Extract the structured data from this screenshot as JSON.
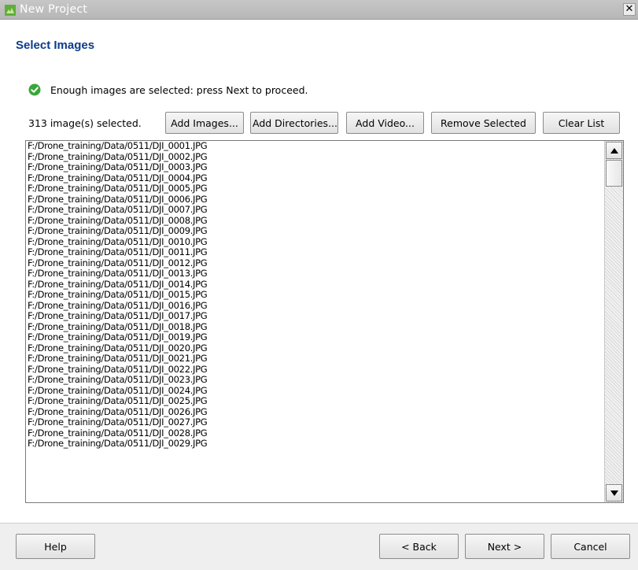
{
  "window": {
    "title": "New Project"
  },
  "header": {
    "title": "Select Images"
  },
  "status": {
    "message": "Enough images are selected: press Next to proceed."
  },
  "selection": {
    "count_text": "313 image(s) selected."
  },
  "toolbar": {
    "add_images": "Add Images...",
    "add_directories": "Add Directories...",
    "add_video": "Add Video...",
    "remove_selected": "Remove Selected",
    "clear_list": "Clear List"
  },
  "files": [
    "F:/Drone_training/Data/0511/DJI_0001.JPG",
    "F:/Drone_training/Data/0511/DJI_0002.JPG",
    "F:/Drone_training/Data/0511/DJI_0003.JPG",
    "F:/Drone_training/Data/0511/DJI_0004.JPG",
    "F:/Drone_training/Data/0511/DJI_0005.JPG",
    "F:/Drone_training/Data/0511/DJI_0006.JPG",
    "F:/Drone_training/Data/0511/DJI_0007.JPG",
    "F:/Drone_training/Data/0511/DJI_0008.JPG",
    "F:/Drone_training/Data/0511/DJI_0009.JPG",
    "F:/Drone_training/Data/0511/DJI_0010.JPG",
    "F:/Drone_training/Data/0511/DJI_0011.JPG",
    "F:/Drone_training/Data/0511/DJI_0012.JPG",
    "F:/Drone_training/Data/0511/DJI_0013.JPG",
    "F:/Drone_training/Data/0511/DJI_0014.JPG",
    "F:/Drone_training/Data/0511/DJI_0015.JPG",
    "F:/Drone_training/Data/0511/DJI_0016.JPG",
    "F:/Drone_training/Data/0511/DJI_0017.JPG",
    "F:/Drone_training/Data/0511/DJI_0018.JPG",
    "F:/Drone_training/Data/0511/DJI_0019.JPG",
    "F:/Drone_training/Data/0511/DJI_0020.JPG",
    "F:/Drone_training/Data/0511/DJI_0021.JPG",
    "F:/Drone_training/Data/0511/DJI_0022.JPG",
    "F:/Drone_training/Data/0511/DJI_0023.JPG",
    "F:/Drone_training/Data/0511/DJI_0024.JPG",
    "F:/Drone_training/Data/0511/DJI_0025.JPG",
    "F:/Drone_training/Data/0511/DJI_0026.JPG",
    "F:/Drone_training/Data/0511/DJI_0027.JPG",
    "F:/Drone_training/Data/0511/DJI_0028.JPG",
    "F:/Drone_training/Data/0511/DJI_0029.JPG"
  ],
  "footer": {
    "help": "Help",
    "back": "< Back",
    "next": "Next >",
    "cancel": "Cancel"
  },
  "colors": {
    "heading": "#0b3c8a",
    "success": "#3aa63a",
    "titlebar": "#b9b9b9"
  }
}
